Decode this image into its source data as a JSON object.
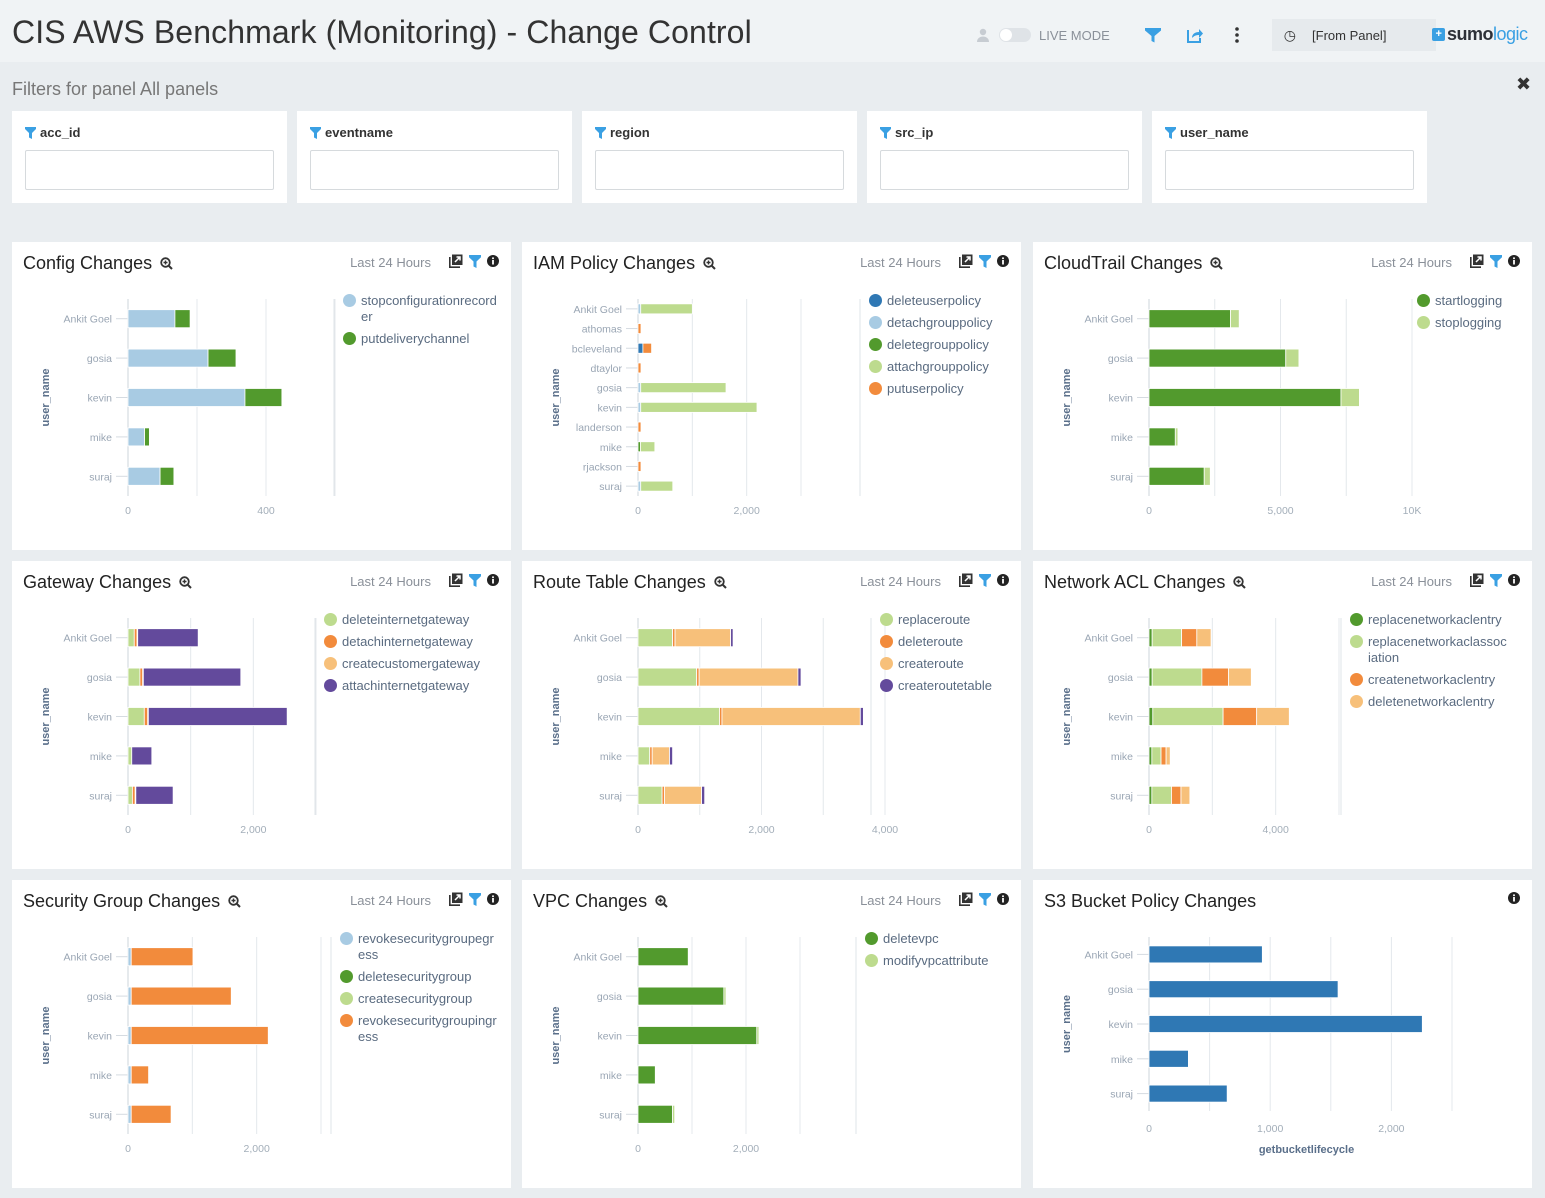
{
  "header": {
    "title": "CIS AWS Benchmark (Monitoring) - Change Control",
    "live_mode_label": "LIVE MODE",
    "time_range": "[From Panel]",
    "logo_sumo": "sumo",
    "logo_logic": "logic",
    "logo_plus": "+"
  },
  "filters": {
    "title": "Filters for panel All panels",
    "close": "✖",
    "fields": [
      {
        "label": "acc_id",
        "value": ""
      },
      {
        "label": "eventname",
        "value": ""
      },
      {
        "label": "region",
        "value": ""
      },
      {
        "label": "src_ip",
        "value": ""
      },
      {
        "label": "user_name",
        "value": ""
      }
    ]
  },
  "colors": {
    "lightblue": "#a8cbe3",
    "darkblue": "#2f78b4",
    "darkgreen": "#529a2d",
    "lightgreen": "#bddb8e",
    "orange": "#f28b3c",
    "peach": "#f7c07a",
    "purple": "#634a9c",
    "accent": "#3aa0e3"
  },
  "chart_data": [
    {
      "id": "config",
      "type": "bar",
      "title": "Config Changes",
      "time": "Last 24 Hours",
      "ylabel": "user_name",
      "xlabel": "",
      "categories": [
        "Ankit Goel",
        "gosia",
        "kevin",
        "mike",
        "suraj"
      ],
      "xlim": [
        0,
        600
      ],
      "ticks": [
        0,
        400
      ],
      "tick_labels": [
        "0",
        "400"
      ],
      "gridlines": [
        0,
        200,
        400,
        600
      ],
      "series": [
        {
          "name": "stopconfigurationrecorder",
          "color": "#a8cbe3",
          "values": [
            136,
            232,
            339,
            48,
            93
          ]
        },
        {
          "name": "putdeliverychannel",
          "color": "#529a2d",
          "values": [
            44,
            81,
            107,
            14,
            40
          ]
        }
      ]
    },
    {
      "id": "iam",
      "type": "bar",
      "title": "IAM Policy Changes",
      "time": "Last 24 Hours",
      "ylabel": "user_name",
      "xlabel": "",
      "categories": [
        "Ankit Goel",
        "athomas",
        "bcleveland",
        "dtaylor",
        "gosia",
        "kevin",
        "landerson",
        "mike",
        "rjackson",
        "suraj"
      ],
      "xlim": [
        0,
        3000
      ],
      "ticks": [
        0,
        2000
      ],
      "tick_labels": [
        "0",
        "2,000"
      ],
      "gridlines": [
        0,
        1000,
        2000,
        3000
      ],
      "series": [
        {
          "name": "deleteuserpolicy",
          "color": "#2f78b4",
          "values": [
            0,
            0,
            90,
            0,
            0,
            0,
            0,
            0,
            0,
            0
          ]
        },
        {
          "name": "detachgrouppolicy",
          "color": "#a8cbe3",
          "values": [
            50,
            0,
            0,
            0,
            50,
            50,
            0,
            0,
            0,
            50
          ]
        },
        {
          "name": "deletegrouppolicy",
          "color": "#529a2d",
          "values": [
            0,
            0,
            0,
            0,
            0,
            0,
            0,
            45,
            0,
            0
          ]
        },
        {
          "name": "attachgrouppolicy",
          "color": "#bddb8e",
          "values": [
            950,
            0,
            0,
            0,
            1570,
            2140,
            0,
            265,
            0,
            590
          ]
        },
        {
          "name": "putuserpolicy",
          "color": "#f28b3c",
          "values": [
            0,
            55,
            160,
            55,
            0,
            0,
            55,
            0,
            55,
            0
          ]
        }
      ]
    },
    {
      "id": "cloudtrail",
      "type": "bar",
      "title": "CloudTrail Changes",
      "time": "Last 24 Hours",
      "ylabel": "user_name",
      "xlabel": "",
      "categories": [
        "Ankit Goel",
        "gosia",
        "kevin",
        "mike",
        "suraj"
      ],
      "xlim": [
        0,
        10000
      ],
      "ticks": [
        0,
        5000,
        10000
      ],
      "tick_labels": [
        "0",
        "5,000",
        "10K"
      ],
      "gridlines": [
        0,
        2500,
        5000,
        7500,
        10000
      ],
      "series": [
        {
          "name": "startlogging",
          "color": "#529a2d",
          "values": [
            3100,
            5200,
            7300,
            1000,
            2100
          ]
        },
        {
          "name": "stoplogging",
          "color": "#bddb8e",
          "values": [
            330,
            500,
            700,
            100,
            230
          ]
        }
      ]
    },
    {
      "id": "gateway",
      "type": "bar",
      "title": "Gateway Changes",
      "time": "Last 24 Hours",
      "ylabel": "user_name",
      "xlabel": "",
      "categories": [
        "Ankit Goel",
        "gosia",
        "kevin",
        "mike",
        "suraj"
      ],
      "xlim": [
        0,
        3000
      ],
      "ticks": [
        0,
        2000
      ],
      "tick_labels": [
        "0",
        "2,000"
      ],
      "gridlines": [
        0,
        1000,
        2000,
        3000
      ],
      "series": [
        {
          "name": "deleteinternetgateway",
          "color": "#bddb8e",
          "values": [
            100,
            190,
            260,
            60,
            70
          ]
        },
        {
          "name": "detachinternetgateway",
          "color": "#f28b3c",
          "values": [
            45,
            45,
            55,
            0,
            45
          ]
        },
        {
          "name": "createcustomergateway",
          "color": "#f7c07a",
          "values": [
            10,
            10,
            10,
            0,
            10
          ]
        },
        {
          "name": "attachinternetgateway",
          "color": "#634a9c",
          "values": [
            965,
            1555,
            2215,
            320,
            595
          ]
        }
      ]
    },
    {
      "id": "route",
      "type": "bar",
      "title": "Route Table Changes",
      "time": "Last 24 Hours",
      "ylabel": "user_name",
      "xlabel": "",
      "categories": [
        "Ankit Goel",
        "gosia",
        "kevin",
        "mike",
        "suraj"
      ],
      "xlim": [
        0,
        4000
      ],
      "ticks": [
        0,
        2000,
        4000
      ],
      "tick_labels": [
        "0",
        "2,000",
        "4,000"
      ],
      "gridlines": [
        0,
        1000,
        2000,
        3000,
        4000
      ],
      "series": [
        {
          "name": "replaceroute",
          "color": "#bddb8e",
          "values": [
            560,
            950,
            1320,
            190,
            390
          ]
        },
        {
          "name": "deleteroute",
          "color": "#f28b3c",
          "values": [
            40,
            40,
            40,
            40,
            40
          ]
        },
        {
          "name": "createroute",
          "color": "#f7c07a",
          "values": [
            900,
            1600,
            2240,
            280,
            600
          ]
        },
        {
          "name": "createroutetable",
          "color": "#634a9c",
          "values": [
            40,
            50,
            50,
            50,
            50
          ]
        }
      ]
    },
    {
      "id": "acl",
      "type": "bar",
      "title": "Network ACL Changes",
      "time": "Last 24 Hours",
      "ylabel": "user_name",
      "xlabel": "",
      "categories": [
        "Ankit Goel",
        "gosia",
        "kevin",
        "mike",
        "suraj"
      ],
      "xlim": [
        0,
        6000
      ],
      "ticks": [
        0,
        4000
      ],
      "tick_labels": [
        "0",
        "4,000"
      ],
      "gridlines": [
        0,
        2000,
        4000,
        6000
      ],
      "series": [
        {
          "name": "replacenetworkaclentry",
          "color": "#529a2d",
          "values": [
            100,
            100,
            120,
            90,
            90
          ]
        },
        {
          "name": "replacenetworkaclassociation",
          "color": "#bddb8e",
          "values": [
            930,
            1570,
            2220,
            290,
            620
          ]
        },
        {
          "name": "createnetworkaclentry",
          "color": "#f28b3c",
          "values": [
            480,
            840,
            1060,
            160,
            300
          ]
        },
        {
          "name": "deletenetworkaclentry",
          "color": "#f7c07a",
          "values": [
            450,
            720,
            1030,
            130,
            280
          ]
        }
      ]
    },
    {
      "id": "security",
      "type": "bar",
      "title": "Security Group Changes",
      "time": "Last 24 Hours",
      "ylabel": "user_name",
      "xlabel": "",
      "categories": [
        "Ankit Goel",
        "gosia",
        "kevin",
        "mike",
        "suraj"
      ],
      "xlim": [
        0,
        3000
      ],
      "ticks": [
        0,
        2000
      ],
      "tick_labels": [
        "0",
        "2,000"
      ],
      "gridlines": [
        0,
        1000,
        2000,
        3000
      ],
      "series": [
        {
          "name": "revokesecuritygroupegress",
          "color": "#a8cbe3",
          "values": [
            50,
            50,
            50,
            50,
            50
          ]
        },
        {
          "name": "deletesecuritygroup",
          "color": "#529a2d",
          "values": [
            0,
            0,
            0,
            0,
            0
          ]
        },
        {
          "name": "createsecuritygroup",
          "color": "#bddb8e",
          "values": [
            0,
            0,
            0,
            0,
            0
          ]
        },
        {
          "name": "revokesecuritygroupingress",
          "color": "#f28b3c",
          "values": [
            960,
            1555,
            2130,
            270,
            620
          ]
        }
      ]
    },
    {
      "id": "vpc",
      "type": "bar",
      "title": "VPC Changes",
      "time": "Last 24 Hours",
      "ylabel": "user_name",
      "xlabel": "",
      "categories": [
        "Ankit Goel",
        "gosia",
        "kevin",
        "mike",
        "suraj"
      ],
      "xlim": [
        0,
        3000
      ],
      "ticks": [
        0,
        2000
      ],
      "tick_labels": [
        "0",
        "2,000"
      ],
      "gridlines": [
        0,
        1000,
        2000,
        3000
      ],
      "series": [
        {
          "name": "deletevpc",
          "color": "#529a2d",
          "values": [
            930,
            1590,
            2200,
            320,
            640
          ]
        },
        {
          "name": "modifyvpcattribute",
          "color": "#bddb8e",
          "values": [
            0,
            40,
            40,
            0,
            40
          ]
        }
      ]
    },
    {
      "id": "s3",
      "type": "bar",
      "title": "S3 Bucket Policy Changes",
      "time": "",
      "ylabel": "user_name",
      "xlabel": "getbucketlifecycle",
      "categories": [
        "Ankit Goel",
        "gosia",
        "kevin",
        "mike",
        "suraj"
      ],
      "xlim": [
        0,
        2500
      ],
      "ticks": [
        0,
        1000,
        2000
      ],
      "tick_labels": [
        "0",
        "1,000",
        "2,000"
      ],
      "gridlines": [
        0,
        500,
        1000,
        1500,
        2000,
        2500
      ],
      "series": [
        {
          "name": "getbucketlifecycle",
          "color": "#2f78b4",
          "values": [
            935,
            1560,
            2255,
            325,
            645
          ]
        }
      ]
    }
  ]
}
